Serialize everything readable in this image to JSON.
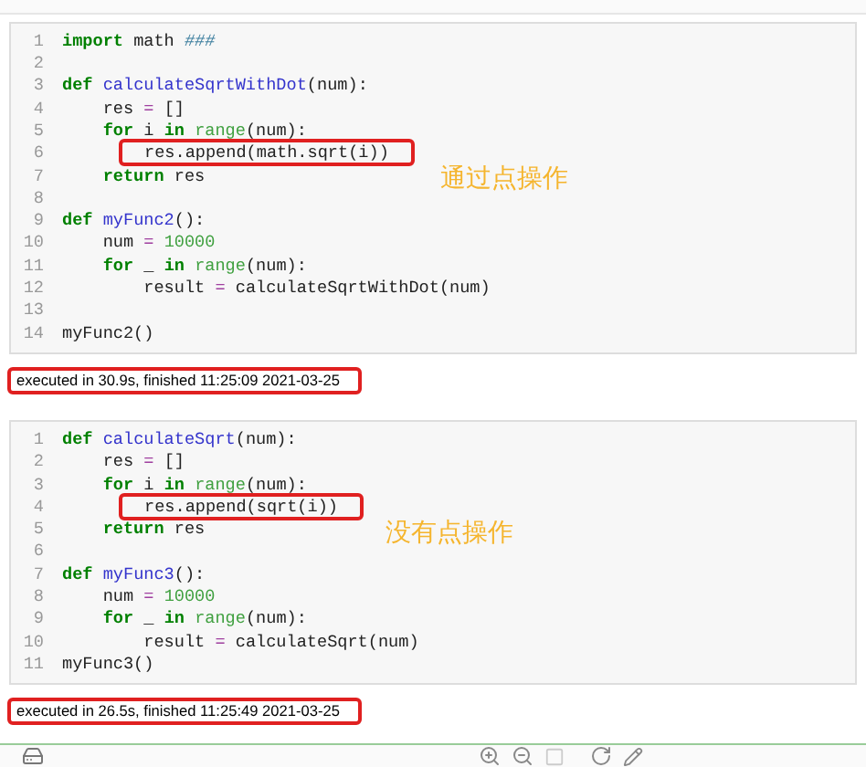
{
  "cells": [
    {
      "lines": [
        {
          "number": "1",
          "tokens": [
            {
              "kind": "kw",
              "text": "import"
            },
            {
              "kind": "plain",
              "text": " math "
            },
            {
              "kind": "comment",
              "text": "###"
            }
          ]
        },
        {
          "number": "2"
        },
        {
          "number": "3",
          "tokens": [
            {
              "kind": "kw",
              "text": "def"
            },
            {
              "kind": "def",
              "text": " calculateSqrtWithDot"
            },
            {
              "kind": "plain",
              "text": "(num):"
            }
          ]
        },
        {
          "number": "4",
          "tokens": [
            {
              "kind": "plain",
              "text": "    res "
            },
            {
              "kind": "op",
              "text": "="
            },
            {
              "kind": "plain",
              "text": " []"
            }
          ]
        },
        {
          "number": "5",
          "tokens": [
            {
              "kind": "kw",
              "text": "    for"
            },
            {
              "kind": "plain",
              "text": " i "
            },
            {
              "kind": "kw",
              "text": "in"
            },
            {
              "kind": "builtin",
              "text": " range"
            },
            {
              "kind": "plain",
              "text": "(num):"
            }
          ]
        },
        {
          "number": "6",
          "boxed": true,
          "tokens": [
            {
              "kind": "plain",
              "text": "res.append(math.sqrt(i))"
            }
          ]
        },
        {
          "number": "7",
          "note": "通过点操作",
          "tokens": [
            {
              "kind": "kw",
              "text": "    return"
            },
            {
              "kind": "plain",
              "text": " res"
            }
          ]
        },
        {
          "number": "8"
        },
        {
          "number": "9",
          "tokens": [
            {
              "kind": "kw",
              "text": "def"
            },
            {
              "kind": "def",
              "text": " myFunc2"
            },
            {
              "kind": "plain",
              "text": "():"
            }
          ]
        },
        {
          "number": "10",
          "tokens": [
            {
              "kind": "plain",
              "text": "    num "
            },
            {
              "kind": "op",
              "text": "="
            },
            {
              "kind": "num",
              "text": " 10000"
            }
          ]
        },
        {
          "number": "11",
          "tokens": [
            {
              "kind": "kw",
              "text": "    for"
            },
            {
              "kind": "plain",
              "text": " _ "
            },
            {
              "kind": "kw",
              "text": "in"
            },
            {
              "kind": "builtin",
              "text": " range"
            },
            {
              "kind": "plain",
              "text": "(num):"
            }
          ]
        },
        {
          "number": "12",
          "tokens": [
            {
              "kind": "plain",
              "text": "        result "
            },
            {
              "kind": "op",
              "text": "="
            },
            {
              "kind": "plain",
              "text": " calculateSqrtWithDot(num)"
            }
          ]
        },
        {
          "number": "13"
        },
        {
          "number": "14",
          "tokens": [
            {
              "kind": "plain",
              "text": "myFunc2()"
            }
          ]
        }
      ],
      "output": "executed in 30.9s, finished 11:25:09 2021-03-25"
    },
    {
      "lines": [
        {
          "number": "1",
          "tokens": [
            {
              "kind": "kw",
              "text": "def"
            },
            {
              "kind": "def",
              "text": " calculateSqrt"
            },
            {
              "kind": "plain",
              "text": "(num):"
            }
          ]
        },
        {
          "number": "2",
          "tokens": [
            {
              "kind": "plain",
              "text": "    res "
            },
            {
              "kind": "op",
              "text": "="
            },
            {
              "kind": "plain",
              "text": " []"
            }
          ]
        },
        {
          "number": "3",
          "tokens": [
            {
              "kind": "kw",
              "text": "    for"
            },
            {
              "kind": "plain",
              "text": " i "
            },
            {
              "kind": "kw",
              "text": "in"
            },
            {
              "kind": "builtin",
              "text": " range"
            },
            {
              "kind": "plain",
              "text": "(num):"
            }
          ]
        },
        {
          "number": "4",
          "boxed": true,
          "tokens": [
            {
              "kind": "plain",
              "text": "res.append(sqrt(i))"
            }
          ]
        },
        {
          "number": "5",
          "note": "没有点操作",
          "tokens": [
            {
              "kind": "kw",
              "text": "    return"
            },
            {
              "kind": "plain",
              "text": " res"
            }
          ]
        },
        {
          "number": "6"
        },
        {
          "number": "7",
          "tokens": [
            {
              "kind": "kw",
              "text": "def"
            },
            {
              "kind": "def",
              "text": " myFunc3"
            },
            {
              "kind": "plain",
              "text": "():"
            }
          ]
        },
        {
          "number": "8",
          "tokens": [
            {
              "kind": "plain",
              "text": "    num "
            },
            {
              "kind": "op",
              "text": "="
            },
            {
              "kind": "num",
              "text": " 10000"
            }
          ]
        },
        {
          "number": "9",
          "tokens": [
            {
              "kind": "kw",
              "text": "    for"
            },
            {
              "kind": "plain",
              "text": " _ "
            },
            {
              "kind": "kw",
              "text": "in"
            },
            {
              "kind": "builtin",
              "text": " range"
            },
            {
              "kind": "plain",
              "text": "(num):"
            }
          ]
        },
        {
          "number": "10",
          "tokens": [
            {
              "kind": "plain",
              "text": "        result "
            },
            {
              "kind": "op",
              "text": "="
            },
            {
              "kind": "plain",
              "text": " calculateSqrt(num)"
            }
          ]
        },
        {
          "number": "11",
          "tokens": [
            {
              "kind": "plain",
              "text": "myFunc3()"
            }
          ]
        }
      ],
      "output": "executed in 26.5s, finished 11:25:49 2021-03-25"
    }
  ]
}
